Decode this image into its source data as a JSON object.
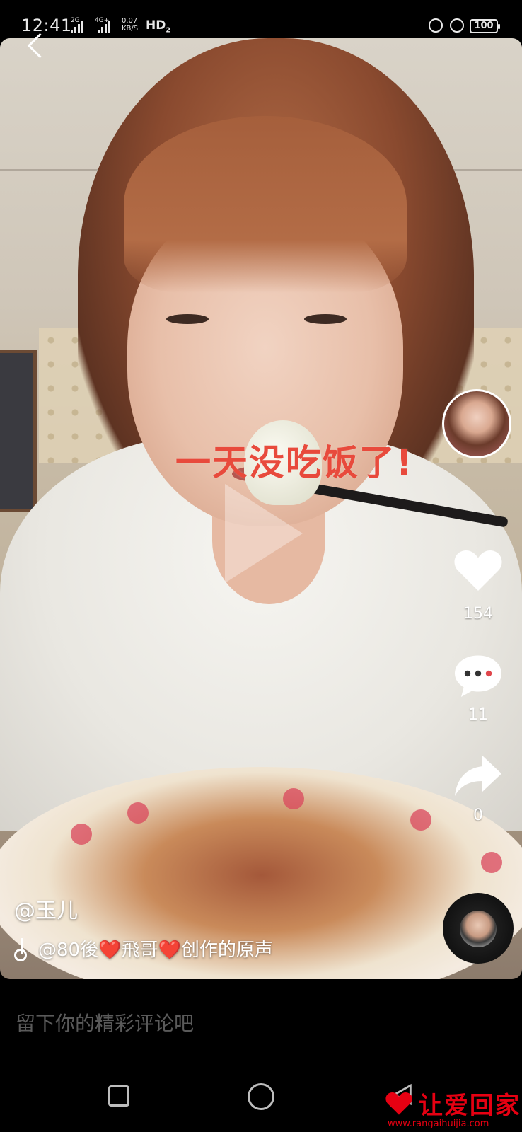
{
  "status_bar": {
    "time": "12:41",
    "sim1_tag": "2G",
    "sim2_tag": "4G+",
    "net_speed_value": "0.07",
    "net_speed_unit": "KB/S",
    "hd_label": "HD",
    "hd_sub": "2",
    "battery": "100"
  },
  "video": {
    "caption": "一天没吃饭了!",
    "author": "@玉儿",
    "music": "@80後❤️飛哥❤️创作的原声",
    "counts": {
      "likes": "154",
      "comments": "11",
      "shares": "0"
    }
  },
  "comment_input": {
    "placeholder": "留下你的精彩评论吧"
  },
  "watermark": {
    "title": "让爱回家",
    "url": "www.rangaihuijia.com"
  },
  "icons": [
    "back-icon",
    "heart-icon",
    "comment-icon",
    "share-icon",
    "music-note-icon",
    "play-icon"
  ],
  "colors": {
    "caption": "#e84a3c",
    "watermark": "#e60012"
  }
}
